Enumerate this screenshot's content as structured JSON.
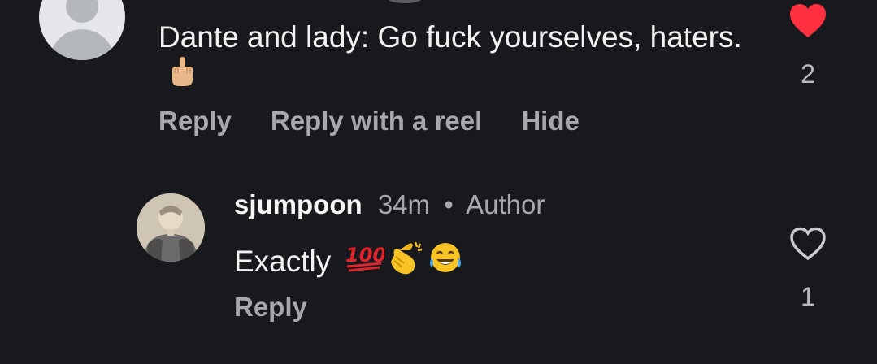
{
  "top_comment": {
    "text": "Dante and lady: Go fuck yourselves, haters.",
    "emoji": "middle-finger-icon",
    "actions": {
      "reply": "Reply",
      "reply_with_reel": "Reply with a reel",
      "hide": "Hide"
    },
    "likes": "2",
    "liked": true
  },
  "reply_comment": {
    "username": "sjumpoon",
    "time": "34m",
    "separator": "•",
    "badge": "Author",
    "text": "Exactly",
    "emojis": [
      "hundred-points-icon",
      "clapping-hands-icon",
      "tears-of-joy-icon"
    ],
    "actions": {
      "reply": "Reply"
    },
    "likes": "1",
    "liked": false
  },
  "colors": {
    "background": "#17191c",
    "heart_liked": "#ff3040",
    "secondary_text": "#a6a8ad"
  }
}
